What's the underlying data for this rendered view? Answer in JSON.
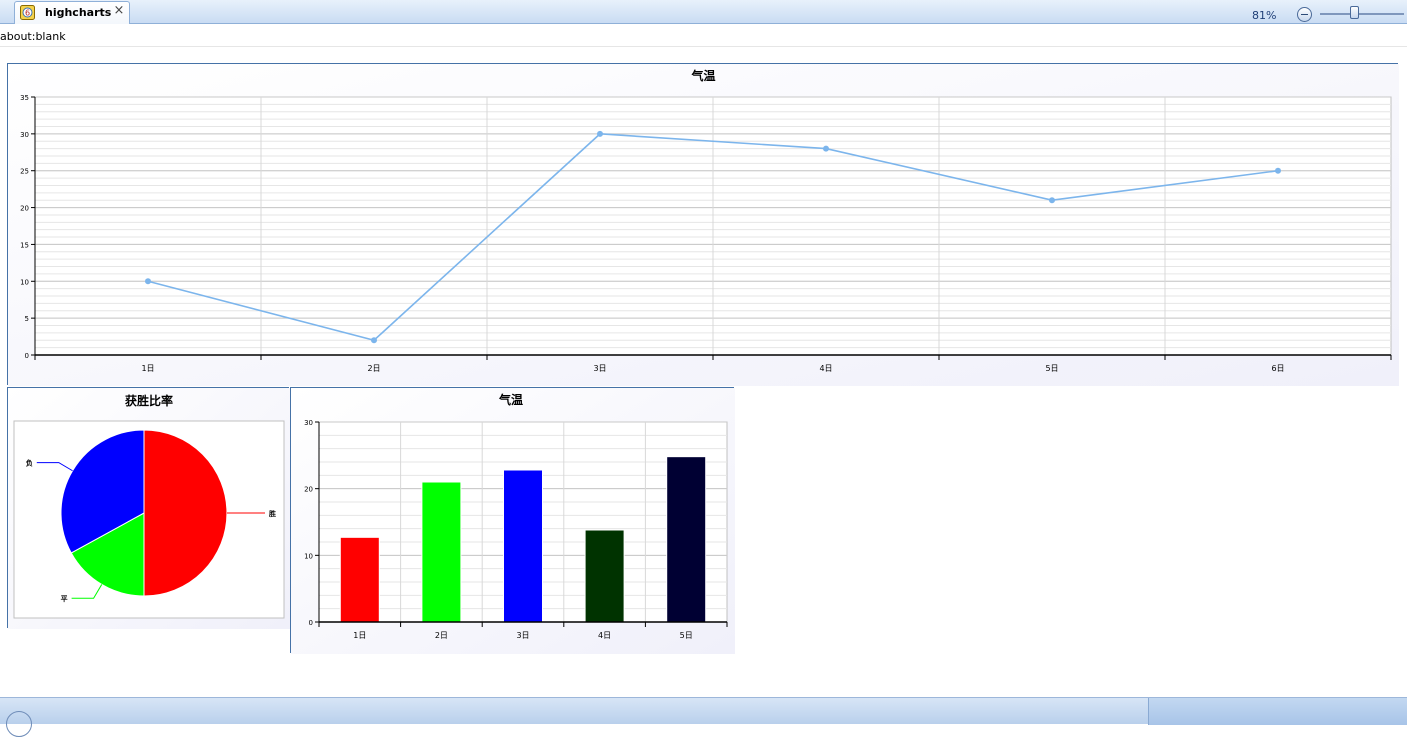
{
  "tab": {
    "title": "highcharts",
    "close": "×",
    "icon": "ie-page-icon"
  },
  "address": "about:blank",
  "status": {
    "zoom": "81%"
  },
  "colors": {
    "line": "#7cb5ec",
    "panel_border": "#4572a7"
  },
  "chart_data": [
    {
      "type": "line",
      "title": "气温",
      "categories": [
        "1日",
        "2日",
        "3日",
        "4日",
        "5日",
        "6日"
      ],
      "series": [
        {
          "values": [
            10,
            2,
            30,
            28,
            21,
            25
          ],
          "color": "#7cb5ec"
        }
      ],
      "ylim": [
        0,
        35
      ],
      "yticks": [
        "0",
        "5",
        "10",
        "15",
        "20",
        "25",
        "30",
        "35"
      ],
      "grid": true
    },
    {
      "type": "pie",
      "title": "获胜比率",
      "slices": [
        {
          "label": "胜",
          "value": 50,
          "color": "#ff0000"
        },
        {
          "label": "平",
          "value": 17,
          "color": "#00ff00"
        },
        {
          "label": "负",
          "value": 33,
          "color": "#0000ff"
        }
      ]
    },
    {
      "type": "bar",
      "title": "气温",
      "categories": [
        "1日",
        "2日",
        "3日",
        "4日",
        "5日"
      ],
      "values": [
        12.7,
        21,
        22.8,
        13.8,
        24.8
      ],
      "colors": [
        "#ff0000",
        "#00ff00",
        "#0000ff",
        "#003300",
        "#000033"
      ],
      "ylim": [
        0,
        30
      ],
      "yticks": [
        "0",
        "10",
        "20",
        "30"
      ],
      "grid": true
    }
  ]
}
